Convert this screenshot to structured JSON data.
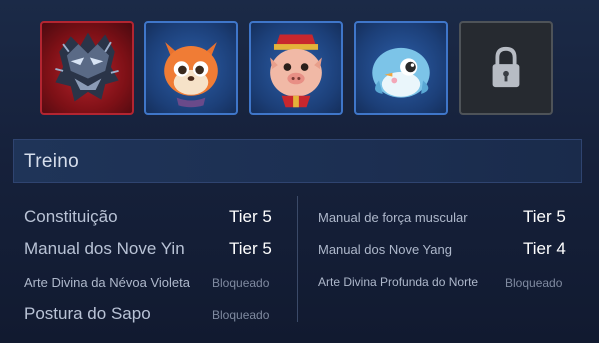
{
  "slots": [
    {
      "name": "dark-armor-icon",
      "state": "equipped",
      "accent": "#b32531"
    },
    {
      "name": "fox-icon",
      "state": "equipped",
      "accent": "#3f76c9"
    },
    {
      "name": "pig-icon",
      "state": "equipped",
      "accent": "#3f76c9"
    },
    {
      "name": "bird-icon",
      "state": "equipped",
      "accent": "#3f76c9"
    },
    {
      "name": "lock-icon",
      "state": "locked",
      "accent": "#4e5358"
    }
  ],
  "section": {
    "title": "Treino"
  },
  "left": [
    {
      "label": "Constituição",
      "value": "Tier 5"
    },
    {
      "label": "Manual dos Nove Yin",
      "value": "Tier 5"
    },
    {
      "label": "Arte Divina da Névoa Violeta",
      "value": "Bloqueado"
    },
    {
      "label": "Postura do Sapo",
      "value": "Bloqueado"
    }
  ],
  "right": [
    {
      "label": "Manual de força muscular",
      "value": "Tier 5"
    },
    {
      "label": "Manual dos Nove Yang",
      "value": "Tier 4"
    },
    {
      "label": "Arte Divina Profunda do Norte",
      "value": "Bloqueado"
    }
  ]
}
